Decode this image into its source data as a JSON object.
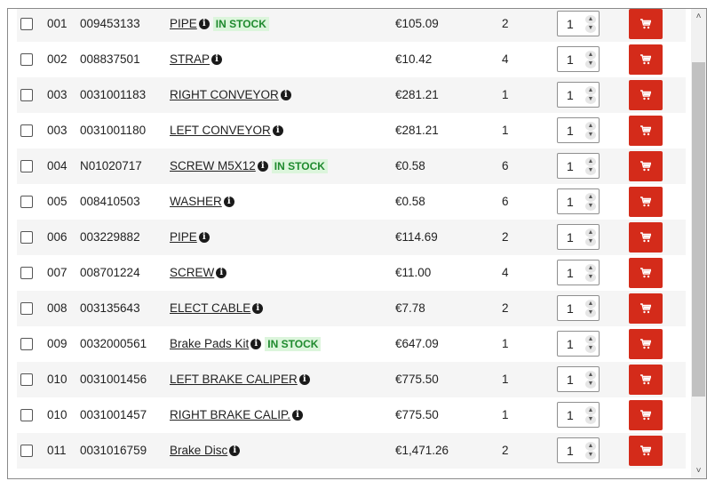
{
  "info_glyph": "i",
  "stepper_up_glyph": "▲",
  "stepper_down_glyph": "▼",
  "scroll_up_glyph": "˄",
  "scroll_down_glyph": "˅",
  "colors": {
    "cart_button": "#d42b1a",
    "stock_badge_bg": "#dcf5dc",
    "stock_badge_text": "#1f8a2e"
  },
  "rows": [
    {
      "ref": "001",
      "code": "009453133",
      "desc": "PIPE ",
      "badge": "IN STOCK",
      "price": "€105.09",
      "qty": "2",
      "order_qty": "1"
    },
    {
      "ref": "002",
      "code": "008837501",
      "desc": "STRAP",
      "badge": "",
      "price": "€10.42",
      "qty": "4",
      "order_qty": "1"
    },
    {
      "ref": "003",
      "code": "0031001183",
      "desc": "RIGHT CONVEYOR",
      "badge": "",
      "price": "€281.21",
      "qty": "1",
      "order_qty": "1"
    },
    {
      "ref": "003",
      "code": "0031001180",
      "desc": "LEFT CONVEYOR ",
      "badge": "",
      "price": "€281.21",
      "qty": "1",
      "order_qty": "1"
    },
    {
      "ref": "004",
      "code": "N01020717",
      "desc": "SCREW M5X12 ",
      "badge": "IN STOCK",
      "price": "€0.58",
      "qty": "6",
      "order_qty": "1"
    },
    {
      "ref": "005",
      "code": "008410503",
      "desc": "WASHER ",
      "badge": "",
      "price": "€0.58",
      "qty": "6",
      "order_qty": "1"
    },
    {
      "ref": "006",
      "code": "003229882",
      "desc": "PIPE ",
      "badge": "",
      "price": "€114.69",
      "qty": "2",
      "order_qty": "1"
    },
    {
      "ref": "007",
      "code": "008701224",
      "desc": "SCREW",
      "badge": "",
      "price": "€11.00",
      "qty": "4",
      "order_qty": "1"
    },
    {
      "ref": "008",
      "code": "003135643",
      "desc": "ELECT CABLE ",
      "badge": "",
      "price": "€7.78",
      "qty": "2",
      "order_qty": "1"
    },
    {
      "ref": "009",
      "code": "0032000561",
      "desc": "Brake Pads Kit",
      "badge": "IN STOCK",
      "price": "€647.09",
      "qty": "1",
      "order_qty": "1"
    },
    {
      "ref": "010",
      "code": "0031001456",
      "desc": "LEFT BRAKE CALIPER ",
      "badge": "",
      "price": "€775.50",
      "qty": "1",
      "order_qty": "1"
    },
    {
      "ref": "010",
      "code": "0031001457",
      "desc": "RIGHT BRAKE CALIP. ",
      "badge": "",
      "price": "€775.50",
      "qty": "1",
      "order_qty": "1"
    },
    {
      "ref": "011",
      "code": "0031016759",
      "desc": "Brake Disc",
      "badge": "",
      "price": "€1,471.26",
      "qty": "2",
      "order_qty": "1"
    }
  ]
}
